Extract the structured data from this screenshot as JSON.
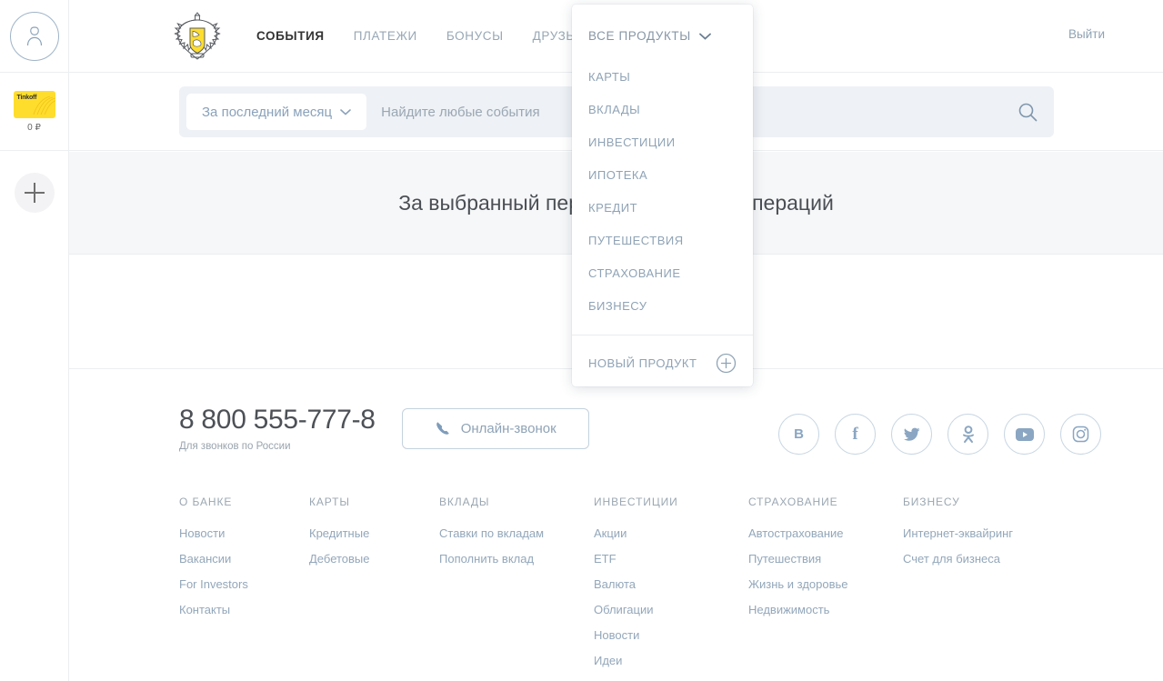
{
  "sidebar": {
    "avatar_icon": "user-avatar-icon",
    "card": {
      "brand": "Tinkoff",
      "balance": "0 ₽"
    },
    "add_button_icon": "plus-icon"
  },
  "header": {
    "logo_icon": "tinkoff-shield-logo",
    "nav": [
      {
        "label": "СОБЫТИЯ",
        "active": true
      },
      {
        "label": "ПЛАТЕЖИ",
        "active": false
      },
      {
        "label": "БОНУСЫ",
        "active": false
      },
      {
        "label": "ДРУЗЬЯ",
        "active": false
      }
    ],
    "products_menu_label": "ВСЕ ПРОДУКТЫ",
    "logout_label": "Выйти"
  },
  "search": {
    "period_label": "За последний месяц",
    "placeholder": "Найдите любые события",
    "value": "",
    "search_icon": "search-icon"
  },
  "banner": {
    "text": "За выбранный период нет никаких операций"
  },
  "dropdown": {
    "title": "ВСЕ ПРОДУКТЫ",
    "items": [
      {
        "label": "КАРТЫ"
      },
      {
        "label": "ВКЛАДЫ"
      },
      {
        "label": "ИНВЕСТИЦИИ"
      },
      {
        "label": "ИПОТЕКА"
      },
      {
        "label": "КРЕДИТ"
      },
      {
        "label": "ПУТЕШЕСТВИЯ"
      },
      {
        "label": "СТРАХОВАНИЕ"
      },
      {
        "label": "БИЗНЕСУ"
      }
    ],
    "footer_label": "НОВЫЙ ПРОДУКТ",
    "footer_icon": "plus-circle-icon"
  },
  "footer": {
    "phone": "8 800 555-777-8",
    "phone_sub": "Для звонков по России",
    "call_button_label": "Онлайн-звонок",
    "call_button_icon": "phone-icon",
    "socials": [
      {
        "name": "vk",
        "glyph": "В"
      },
      {
        "name": "facebook",
        "glyph": "f"
      },
      {
        "name": "twitter",
        "glyph": "twitter-bird"
      },
      {
        "name": "odnoklassniki",
        "glyph": "OK"
      },
      {
        "name": "youtube",
        "glyph": "play"
      },
      {
        "name": "instagram",
        "glyph": "camera"
      }
    ],
    "columns": [
      {
        "title": "О БАНКЕ",
        "links": [
          "Новости",
          "Вакансии",
          "For Investors",
          "Контакты"
        ]
      },
      {
        "title": "КАРТЫ",
        "links": [
          "Кредитные",
          "Дебетовые"
        ]
      },
      {
        "title": "ВКЛАДЫ",
        "links": [
          "Ставки по вкладам",
          "Пополнить вклад"
        ]
      },
      {
        "title": "ИНВЕСТИЦИИ",
        "links": [
          "Акции",
          "ETF",
          "Валюта",
          "Облигации",
          "Новости",
          "Идеи"
        ]
      },
      {
        "title": "СТРАХОВАНИЕ",
        "links": [
          "Автострахование",
          "Путешествия",
          "Жизнь и здоровье",
          "Недвижимость"
        ]
      },
      {
        "title": "БИЗНЕСУ",
        "links": [
          "Интернет-эквайринг",
          "Счет для бизнеса"
        ]
      }
    ]
  },
  "colors": {
    "brand_yellow": "#ffdd2d",
    "muted_blue": "#8fa3b6",
    "banner_bg": "#f6f7f8",
    "search_bg": "#eef1f5",
    "border": "#eceef0"
  }
}
